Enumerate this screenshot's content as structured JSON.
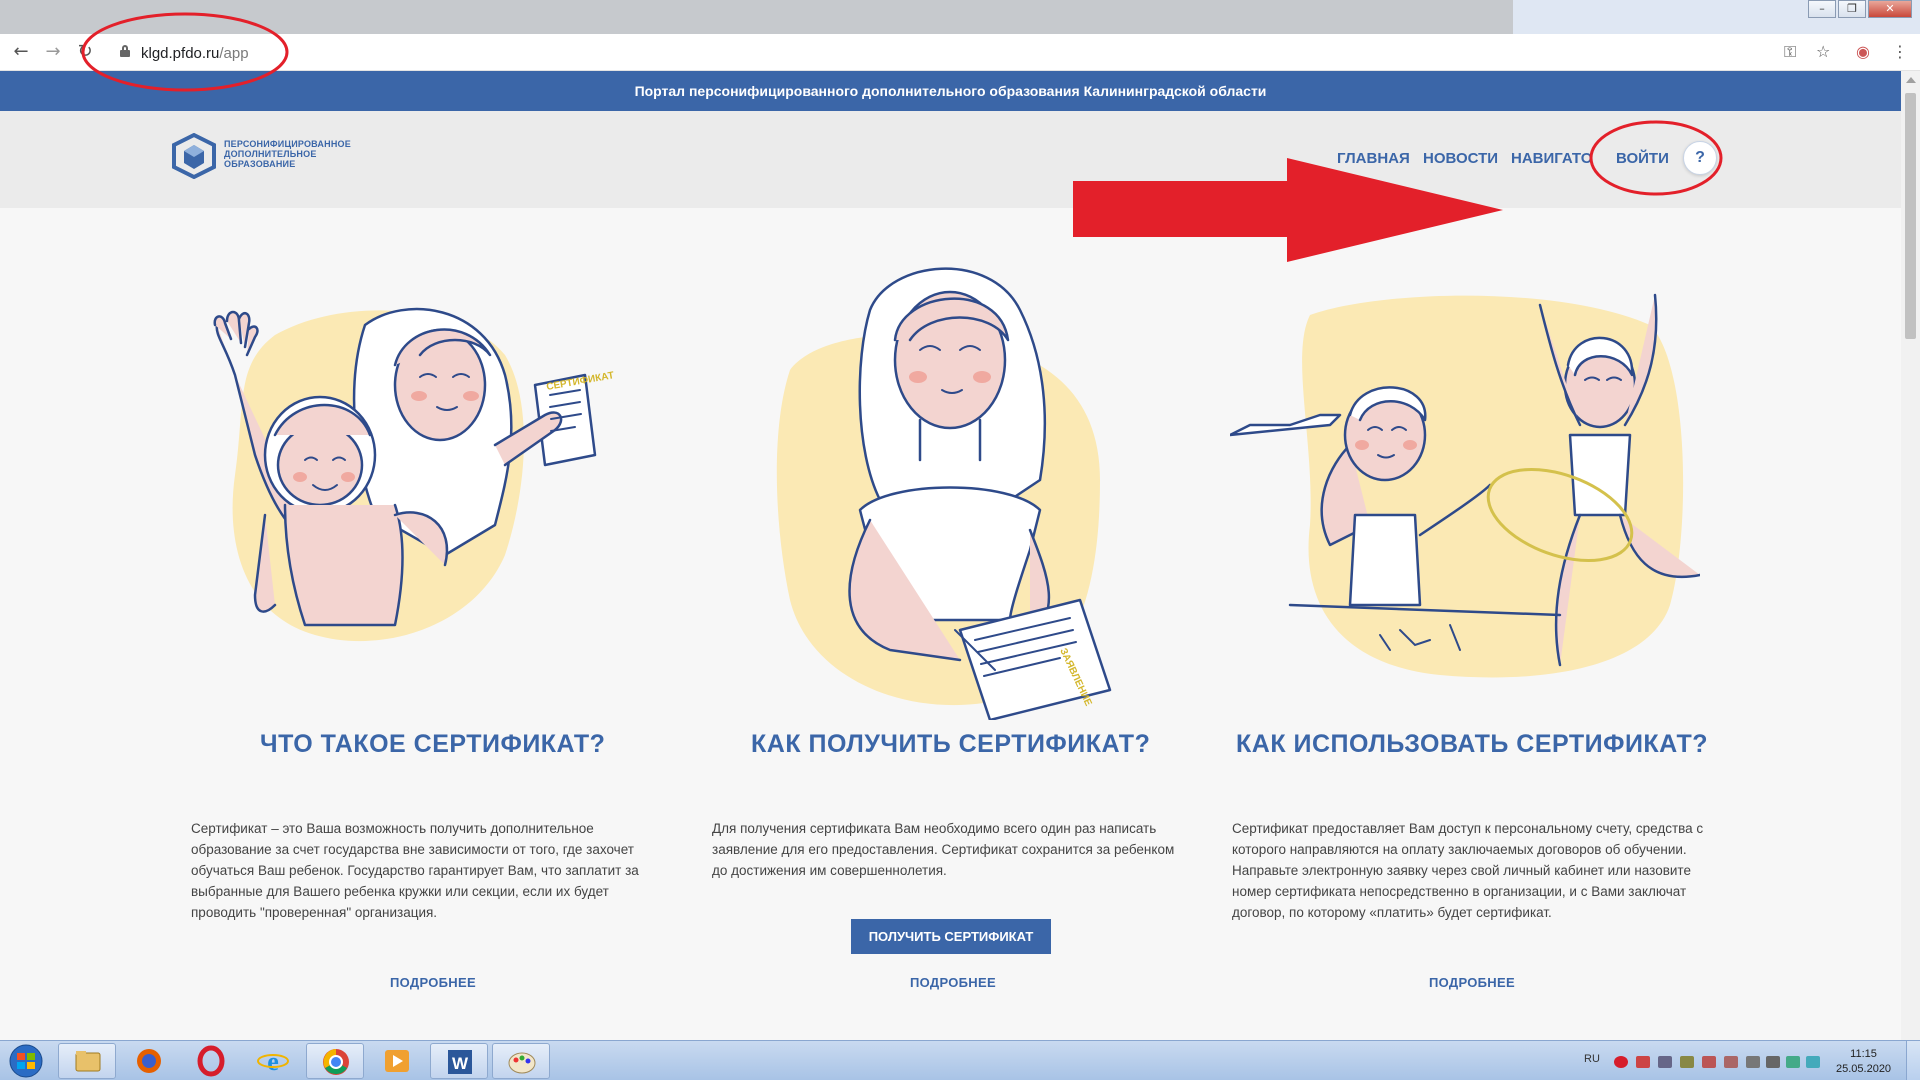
{
  "browser": {
    "url_host": "klgd.pfdo.ru",
    "url_path": "/app",
    "window_controls": [
      "minimize",
      "restore",
      "close"
    ]
  },
  "site": {
    "banner": "Портал персонифицированного дополнительного образования Калининградской области",
    "logo_lines": [
      "ПЕРСОНИФИЦИРОВАННОЕ",
      "ДОПОЛНИТЕЛЬНОЕ",
      "ОБРАЗОВАНИЕ"
    ],
    "nav": {
      "home": "ГЛАВНАЯ",
      "news": "НОВОСТИ",
      "navigator": "НАВИГАТОР",
      "login": "ВОЙТИ",
      "help": "?"
    }
  },
  "columns": [
    {
      "title": "ЧТО ТАКОЕ СЕРТИФИКАТ?",
      "text": "Сертификат – это Ваша возможность получить дополнительное образование за счет государства вне зависимости от того, где захочет обучаться Ваш ребенок. Государство гарантирует Вам, что заплатит за выбранные для Вашего ребенка кружки или секции, если их будет проводить \"проверенная\" организация.",
      "more": "ПОДРОБНЕЕ",
      "illustration_doc": "СЕРТИФИКАТ"
    },
    {
      "title": "КАК ПОЛУЧИТЬ СЕРТИФИКАТ?",
      "text": "Для получения сертификата Вам необходимо всего один раз написать заявление для его предоставления. Сертификат сохранится за ребенком до достижения им совершеннолетия.",
      "button": "ПОЛУЧИТЬ СЕРТИФИКАТ",
      "more": "ПОДРОБНЕЕ",
      "illustration_doc": "ЗАЯВЛЕНИЕ"
    },
    {
      "title": "КАК ИСПОЛЬЗОВАТЬ СЕРТИФИКАТ?",
      "text": "Сертификат предоставляет Вам доступ к персональному счету, средства с которого направляются на оплату заключаемых договоров об обучении. Направьте электронную заявку через свой личный кабинет или назовите номер сертификата непосредственно в организации, и с Вами заключат договор, по которому «платить» будет сертификат.",
      "more": "ПОДРОБНЕЕ"
    }
  ],
  "taskbar": {
    "language": "RU",
    "time": "11:15",
    "date": "25.05.2020",
    "apps": [
      "explorer",
      "firefox",
      "opera",
      "internet-explorer",
      "chrome",
      "media-player",
      "word",
      "paint"
    ]
  },
  "colors": {
    "brand_blue": "#3b66a8",
    "annotation_red": "#e3202a",
    "illustration_yellow": "#fbe9b4",
    "skin": "#f3d4d0"
  }
}
